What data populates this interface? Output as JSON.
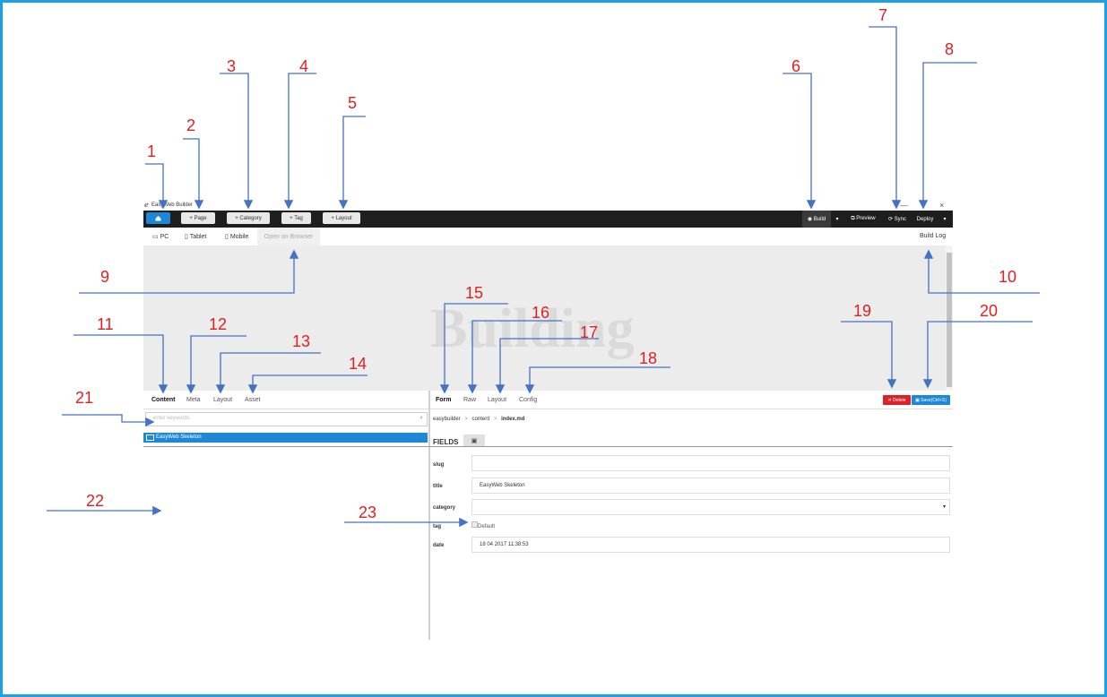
{
  "window": {
    "title": "EasyWeb Builder",
    "close": "×",
    "minimize": "—"
  },
  "toolbar": {
    "page": "+ Page",
    "category": "+ Category",
    "tag": "+ Tag",
    "layout": "+ Layout",
    "build": "◉ Build",
    "build_dropdown": "▾",
    "preview": "⧉ Preview",
    "sync": "⟳ Sync",
    "deploy": "Deploy",
    "deploy_dropdown": "▾"
  },
  "device_tabs": {
    "pc": "PC",
    "tablet": "Tablet",
    "mobile": "Mobile",
    "open_browser": "Open on Browser",
    "build_log": "Build Log"
  },
  "preview": {
    "watermark": "Building"
  },
  "left": {
    "tabs": [
      "Content",
      "Meta",
      "Layout",
      "Asset"
    ],
    "search_placeholder": "enter keywords",
    "tree_item": "EasyWeb Skeleton"
  },
  "right": {
    "tabs": [
      "Form",
      "Raw",
      "Layout",
      "Config"
    ],
    "delete": "✕ Delete",
    "save": "▣ Save(Ctrl+S)",
    "breadcrumb": [
      "easybuilder",
      ">",
      "content",
      ">",
      "index.md"
    ],
    "fields_title": "FIELDS",
    "fields": {
      "slug": {
        "label": "slug",
        "value": ""
      },
      "title": {
        "label": "title",
        "value": "EasyWeb Skeleton"
      },
      "category": {
        "label": "category",
        "value": ""
      },
      "tag": {
        "label": "tag",
        "option": "Default"
      },
      "date": {
        "label": "date",
        "value": "18 04 2017 11:38:53"
      }
    }
  },
  "annotations": [
    "1",
    "2",
    "3",
    "4",
    "5",
    "6",
    "7",
    "8",
    "9",
    "10",
    "11",
    "12",
    "13",
    "14",
    "15",
    "16",
    "17",
    "18",
    "19",
    "20",
    "21",
    "22",
    "23"
  ],
  "colors": {
    "frame": "#1ea0e6",
    "annotation_text": "#e02020",
    "arrow": "#4472c4",
    "primary": "#1e88d8",
    "danger": "#d9232a",
    "toolbar_bg": "#1e1e1e"
  }
}
